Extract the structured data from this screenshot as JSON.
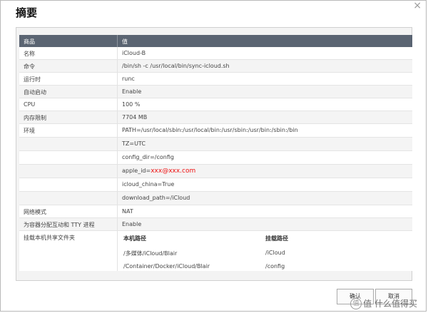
{
  "dialog": {
    "title": "摘要",
    "close_glyph": "×"
  },
  "table": {
    "header": {
      "key": "商品",
      "value": "值"
    },
    "rows": [
      {
        "key": "名称",
        "value": "iCloud-B"
      },
      {
        "key": "命令",
        "value": "/bin/sh -c /usr/local/bin/sync-icloud.sh"
      },
      {
        "key": "运行时",
        "value": "runc"
      },
      {
        "key": "自动启动",
        "value": "Enable"
      },
      {
        "key": "CPU",
        "value": "100 %"
      },
      {
        "key": "内存限制",
        "value": "7704 MB"
      },
      {
        "key": "环境",
        "value": "PATH=/usr/local/sbin:/usr/local/bin:/usr/sbin:/usr/bin:/sbin:/bin"
      },
      {
        "key": "",
        "value": "TZ=UTC"
      },
      {
        "key": "",
        "value": "config_dir=/config"
      },
      {
        "key": "",
        "value_prefix": "apple_id=",
        "value_red": "xxx@xxx.com"
      },
      {
        "key": "",
        "value": "icloud_china=True"
      },
      {
        "key": "",
        "value": "download_path=/iCloud"
      },
      {
        "key": "网络模式",
        "value": "NAT"
      },
      {
        "key": "为容器分配互动和 TTY 进程",
        "value": "Enable"
      }
    ],
    "mount": {
      "key": "挂载本机共享文件夹",
      "headers": {
        "host": "本机路径",
        "container": "挂载路径"
      },
      "rows": [
        {
          "host": "/多媒体/iCloud/Blair",
          "container": "/iCloud"
        },
        {
          "host": "/Container/Docker/iCloud/Blair",
          "container": "/config"
        }
      ]
    }
  },
  "buttons": {
    "ok": "确认",
    "cancel": "取消"
  },
  "watermark": "值 什么值得买"
}
